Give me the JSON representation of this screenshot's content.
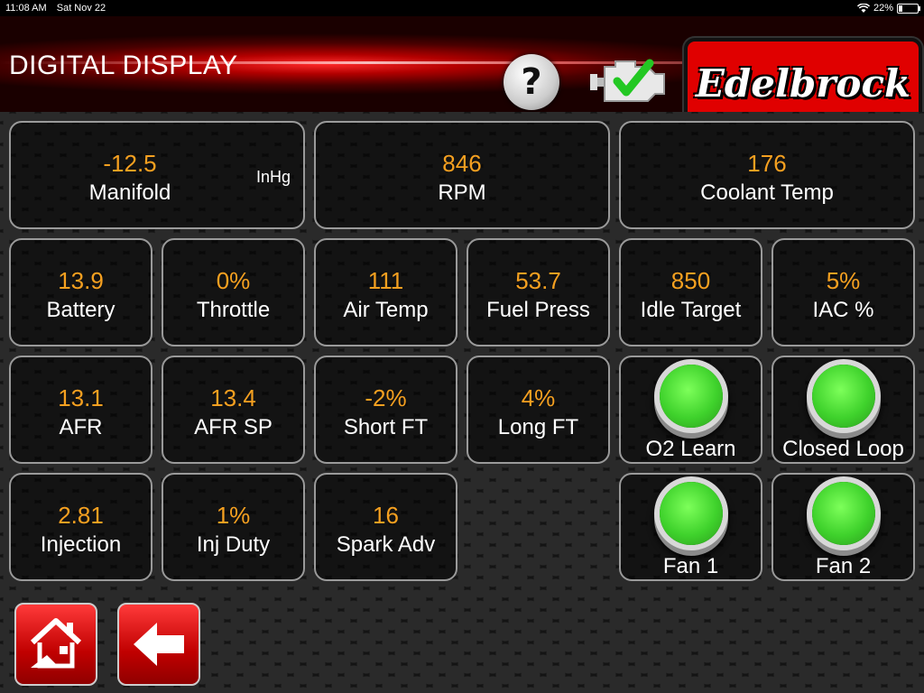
{
  "status_bar": {
    "time": "11:08 AM",
    "date": "Sat Nov 22",
    "battery": "22%",
    "battery_level": 0.22
  },
  "header": {
    "title": "DIGITAL DISPLAY",
    "help_symbol": "?",
    "engine_icon": "check-engine-ok-icon",
    "brand": "Edelbrock"
  },
  "colors": {
    "value": "#f5a020",
    "label": "#ffffff",
    "lamp_on": "#3fd22c",
    "header_red": "#b30000"
  },
  "gauges": {
    "manifold": {
      "value": "-12.5",
      "label": "Manifold",
      "unit": "InHg"
    },
    "rpm": {
      "value": "846",
      "label": "RPM"
    },
    "coolant": {
      "value": "176",
      "label": "Coolant Temp"
    },
    "battery": {
      "value": "13.9",
      "label": "Battery"
    },
    "throttle": {
      "value": "0%",
      "label": "Throttle"
    },
    "air_temp": {
      "value": "111",
      "label": "Air Temp"
    },
    "fuel_press": {
      "value": "53.7",
      "label": "Fuel Press"
    },
    "idle_target": {
      "value": "850",
      "label": "Idle Target"
    },
    "iac": {
      "value": "5%",
      "label": "IAC %"
    },
    "afr": {
      "value": "13.1",
      "label": "AFR"
    },
    "afr_sp": {
      "value": "13.4",
      "label": "AFR SP"
    },
    "short_ft": {
      "value": "-2%",
      "label": "Short FT"
    },
    "long_ft": {
      "value": "4%",
      "label": "Long FT"
    },
    "injection": {
      "value": "2.81",
      "label": "Injection"
    },
    "inj_duty": {
      "value": "1%",
      "label": "Inj Duty"
    },
    "spark_adv": {
      "value": "16",
      "label": "Spark Adv"
    }
  },
  "indicators": {
    "o2_learn": {
      "label": "O2 Learn",
      "state": "on"
    },
    "closed_loop": {
      "label": "Closed Loop",
      "state": "on"
    },
    "fan1": {
      "label": "Fan 1",
      "state": "on"
    },
    "fan2": {
      "label": "Fan 2",
      "state": "on"
    }
  },
  "nav": {
    "home_icon": "home-icon",
    "back_icon": "back-arrow-icon"
  }
}
